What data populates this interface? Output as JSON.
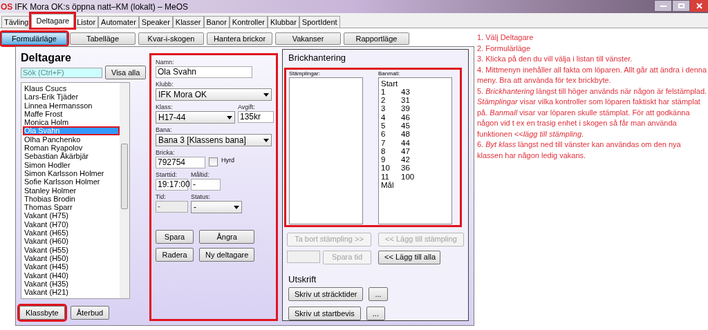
{
  "window": {
    "icon_text": "OS",
    "title": "IFK Mora OK:s öppna natt–KM (lokalt) – MeOS"
  },
  "tabs": [
    {
      "label": "Tävling",
      "selected": false,
      "highlighted": false
    },
    {
      "label": "Deltagare",
      "selected": true,
      "highlighted": true
    },
    {
      "label": "Listor",
      "selected": false,
      "highlighted": false
    },
    {
      "label": "Automater",
      "selected": false,
      "highlighted": false
    },
    {
      "label": "Speaker",
      "selected": false,
      "highlighted": false
    },
    {
      "label": "Klasser",
      "selected": false,
      "highlighted": false
    },
    {
      "label": "Banor",
      "selected": false,
      "highlighted": false
    },
    {
      "label": "Kontroller",
      "selected": false,
      "highlighted": false
    },
    {
      "label": "Klubbar",
      "selected": false,
      "highlighted": false
    },
    {
      "label": "SportIdent",
      "selected": false,
      "highlighted": false
    }
  ],
  "mode_buttons": [
    {
      "label": "Formulärläge",
      "selected": true,
      "highlighted": true
    },
    {
      "label": "Tabelläge",
      "selected": false,
      "highlighted": false
    },
    {
      "label": "Kvar-i-skogen",
      "selected": false,
      "highlighted": false
    },
    {
      "label": "Hantera brickor",
      "selected": false,
      "highlighted": false
    },
    {
      "label": "Vakanser",
      "selected": false,
      "highlighted": false
    },
    {
      "label": "Rapportläge",
      "selected": false,
      "highlighted": false
    }
  ],
  "runner_list": {
    "title": "Deltagare",
    "search": {
      "placeholder": "Sök (Ctrl+F)"
    },
    "show_all_button": "Visa alla",
    "items": [
      {
        "name": "Klaus Csucs",
        "selected": false
      },
      {
        "name": "Lars-Erik Tjäder",
        "selected": false
      },
      {
        "name": "Linnea Hermansson",
        "selected": false
      },
      {
        "name": "Maffe Frost",
        "selected": false
      },
      {
        "name": "Monica Holm",
        "selected": false
      },
      {
        "name": "Ola Svahn",
        "selected": true
      },
      {
        "name": "Olha Panchenko",
        "selected": false
      },
      {
        "name": "Roman Ryapolov",
        "selected": false
      },
      {
        "name": "Sebastian Åkärbjär",
        "selected": false
      },
      {
        "name": "Simon Hodler",
        "selected": false
      },
      {
        "name": "Simon Karlsson Holmer",
        "selected": false
      },
      {
        "name": "Sofie Karlsson Holmer",
        "selected": false
      },
      {
        "name": "Stanley Holmer",
        "selected": false
      },
      {
        "name": "Thobias Brodin",
        "selected": false
      },
      {
        "name": "Thomas Sparr",
        "selected": false
      },
      {
        "name": "Vakant (H75)",
        "selected": false
      },
      {
        "name": "Vakant (H70)",
        "selected": false
      },
      {
        "name": "Vakant (H65)",
        "selected": false
      },
      {
        "name": "Vakant (H60)",
        "selected": false
      },
      {
        "name": "Vakant (H55)",
        "selected": false
      },
      {
        "name": "Vakant (H50)",
        "selected": false
      },
      {
        "name": "Vakant (H45)",
        "selected": false
      },
      {
        "name": "Vakant (H40)",
        "selected": false
      },
      {
        "name": "Vakant (H35)",
        "selected": false
      },
      {
        "name": "Vakant (H21)",
        "selected": false
      }
    ],
    "selection_highlighted": true,
    "buttons": [
      {
        "label": "Klassbyte",
        "highlighted": true
      },
      {
        "label": "Återbud",
        "highlighted": false
      }
    ]
  },
  "runner_form": {
    "highlighted": true,
    "name": {
      "label": "Namn:",
      "value": "Ola Svahn"
    },
    "club": {
      "label": "Klubb:",
      "value": "IFK Mora OK"
    },
    "class": {
      "label": "Klass:",
      "value": "H17-44"
    },
    "fee": {
      "label": "Avgift:",
      "value": "135kr"
    },
    "course": {
      "label": "Bana:",
      "value": "Bana 3 [Klassens bana]"
    },
    "card": {
      "label": "Bricka:",
      "value": "792754"
    },
    "rented": {
      "label": "Hyrd",
      "checked": false
    },
    "start_time": {
      "label": "Starttid:",
      "value": "19:17:00"
    },
    "finish_time": {
      "label": "Måltid:",
      "value": "-"
    },
    "time": {
      "label": "Tid:",
      "value": "-",
      "disabled": true
    },
    "status": {
      "label": "Status:",
      "value": "-"
    },
    "buttons": [
      "Spara",
      "Ångra",
      "Radera",
      "Ny deltagare"
    ]
  },
  "card_panel": {
    "title": "Brickhantering",
    "lists_highlighted": true,
    "punches": {
      "label": "Stämplingar:"
    },
    "course_template": {
      "label": "Banmall:",
      "rows": [
        {
          "leg": "Start"
        },
        {
          "leg": "1",
          "control": "43"
        },
        {
          "leg": "2",
          "control": "31"
        },
        {
          "leg": "3",
          "control": "39"
        },
        {
          "leg": "4",
          "control": "46"
        },
        {
          "leg": "5",
          "control": "45"
        },
        {
          "leg": "6",
          "control": "48"
        },
        {
          "leg": "7",
          "control": "44"
        },
        {
          "leg": "8",
          "control": "47"
        },
        {
          "leg": "9",
          "control": "42"
        },
        {
          "leg": "10",
          "control": "36"
        },
        {
          "leg": "11",
          "control": "100"
        },
        {
          "leg": "Mål"
        }
      ]
    },
    "remove_punch": {
      "label": "Ta bort stämpling >>",
      "disabled": true
    },
    "add_punch": {
      "label": "<< Lägg till stämpling",
      "disabled": true
    },
    "save_time": {
      "label": "Spara tid",
      "disabled": true
    },
    "add_all": {
      "label": "<< Lägg till alla",
      "disabled": false
    },
    "print_title": "Utskrift",
    "print_buttons": [
      {
        "label": "Skriv ut sträcktider",
        "more": "..."
      },
      {
        "label": "Skriv ut startbevis",
        "more": "..."
      }
    ]
  },
  "notes": [
    "1. Välj Deltagare",
    "2. Formulärläge",
    "3. Klicka på den du vill välja i listan till vänster.",
    "4. Mittmenyn inehåller all fakta om löparen. Allt går att ändra i denna meny. Bra att använda för tex brickbyte.",
    "5. *Brickhantering* längst till höger används när någon är felstämplad. *Stämplingar* visar vilka kontroller som löparen faktiskt har stämplat på. *Banmall* visar var löparen skulle stämplat. För att godkänna någon vid t ex en trasig enhet i skogen så får man använda funktionen *<<lägg till stämpling*.",
    "6. *Byt klass* längst ned till vänster kan användas om den nya klassen har någon ledig vakans."
  ]
}
